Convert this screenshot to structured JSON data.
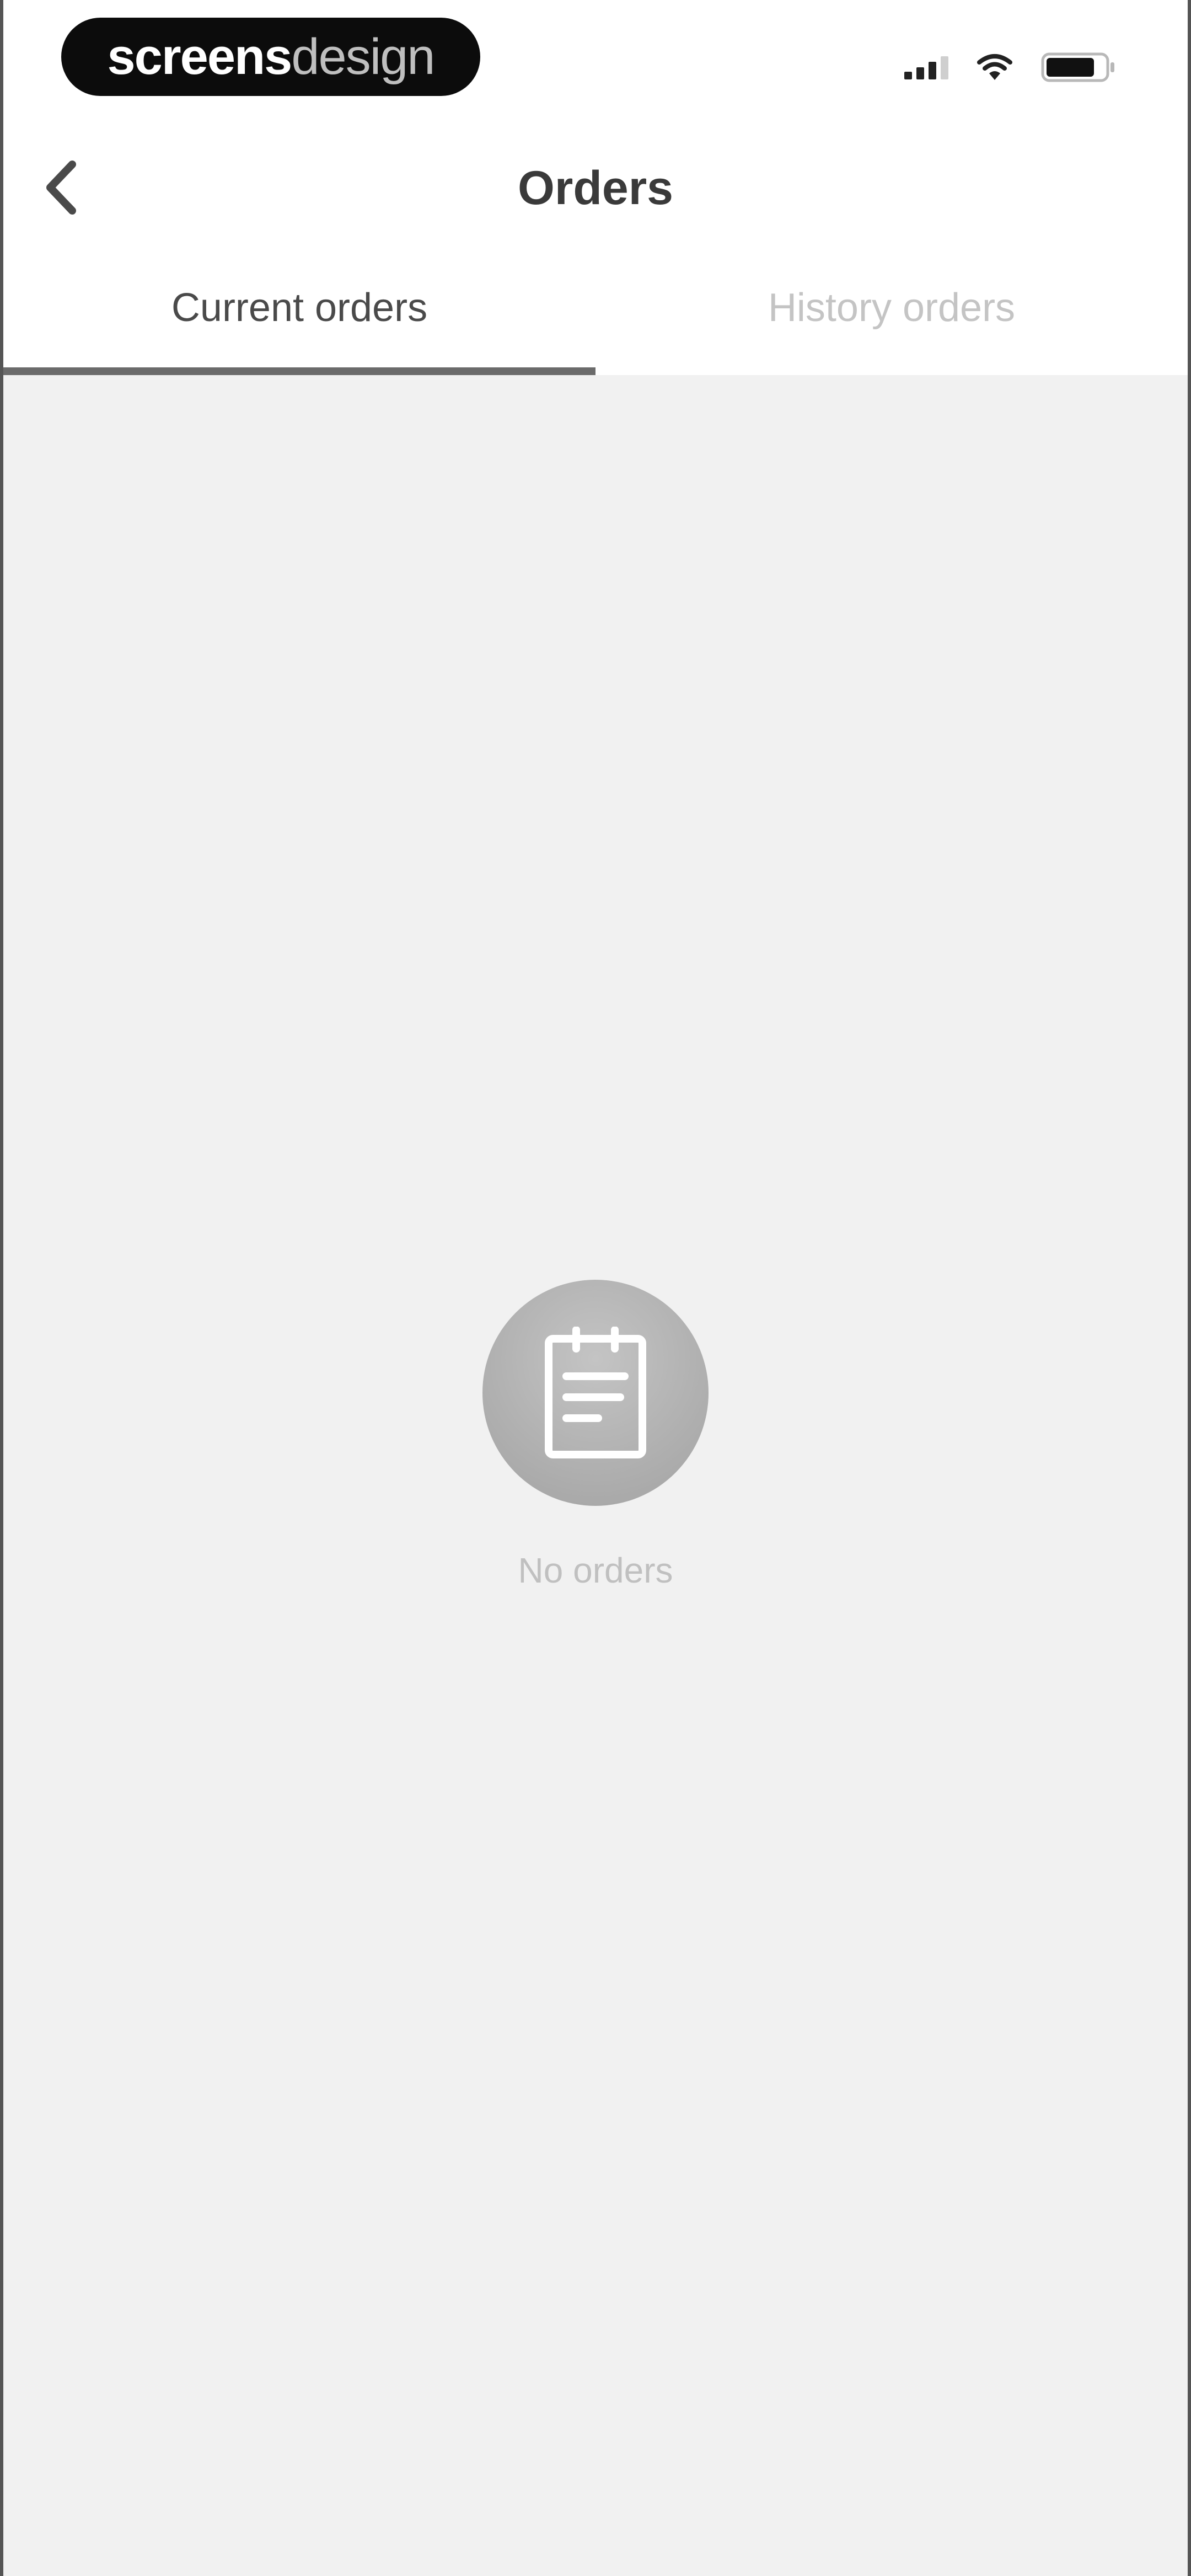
{
  "status_bar": {
    "brand_bold": "screens",
    "brand_light": "design",
    "icons": [
      "signal-icon",
      "wifi-icon",
      "battery-icon"
    ]
  },
  "header": {
    "title": "Orders",
    "back_icon": "chevron-left-icon"
  },
  "tabs": [
    {
      "label": "Current orders",
      "active": true
    },
    {
      "label": "History orders",
      "active": false
    }
  ],
  "empty_state": {
    "icon": "clipboard-icon",
    "message": "No orders"
  },
  "colors": {
    "background": "#f1f1f1",
    "active_tab_text": "#4a4a4a",
    "inactive_tab_text": "#c4c4c4",
    "tab_indicator": "#6b6b6b"
  }
}
